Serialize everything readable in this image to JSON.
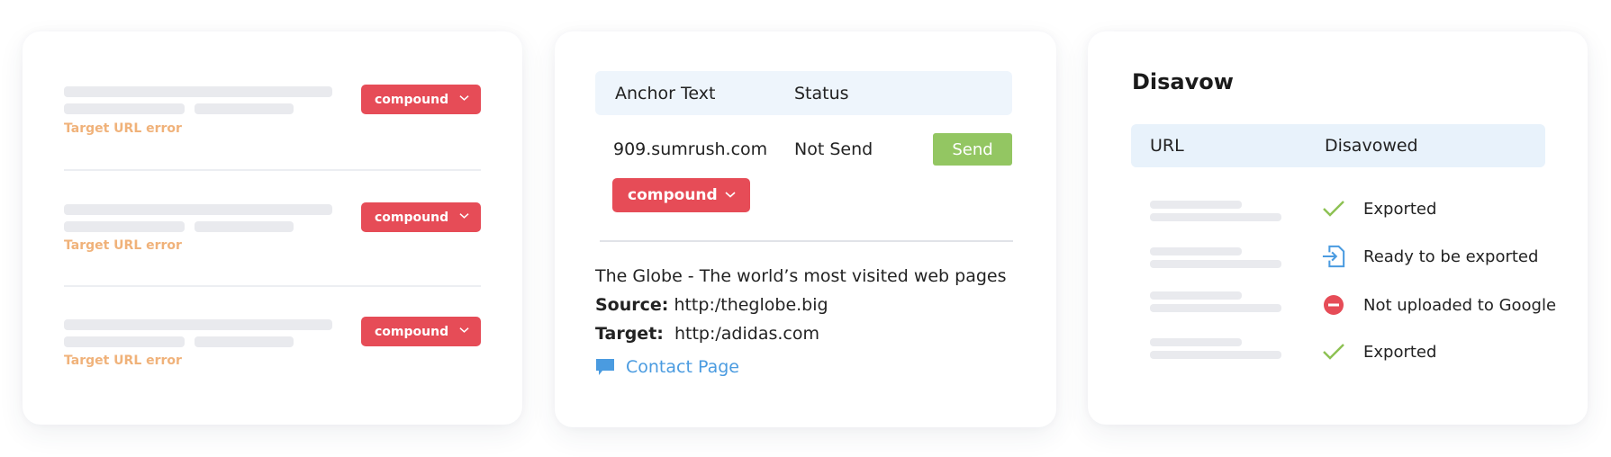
{
  "colors": {
    "compound_bg": "#e64c57",
    "error_text": "#f0b27a",
    "send_bg": "#93c662",
    "link": "#4a9be0",
    "table_header_bg": "#eef5fc",
    "skeleton": "#e9eaee",
    "check": "#8cc152",
    "blocked": "#e64c57"
  },
  "card1": {
    "rows": [
      {
        "error": "Target URL error",
        "action": {
          "label": "compound",
          "icon": "chevron-down-icon"
        }
      },
      {
        "error": "Target URL error",
        "action": {
          "label": "compound",
          "icon": "chevron-down-icon"
        }
      },
      {
        "error": "Target URL error",
        "action": {
          "label": "compound",
          "icon": "chevron-down-icon"
        }
      }
    ]
  },
  "card2": {
    "table": {
      "headers": [
        "Anchor Text",
        "Status"
      ],
      "row": {
        "anchor": "909.sumrush.com",
        "status": "Not Send",
        "send_label": "Send",
        "compound_label": "compound"
      }
    },
    "details": {
      "title": "The Globe - The world’s most visited web pages",
      "source_label": "Source:",
      "source_value": "http:/theglobe.big",
      "target_label": "Target:",
      "target_value": "http:/adidas.com",
      "contact_icon": "chat-bubble-icon",
      "contact_label": "Contact Page"
    }
  },
  "card3": {
    "title": "Disavow",
    "headers": [
      "URL",
      "Disavowed"
    ],
    "rows": [
      {
        "icon": "check-icon",
        "status": "Exported"
      },
      {
        "icon": "file-import-icon",
        "status": "Ready to be exported"
      },
      {
        "icon": "minus-circle-icon",
        "status": "Not uploaded to Google"
      },
      {
        "icon": "check-icon",
        "status": "Exported"
      }
    ]
  }
}
